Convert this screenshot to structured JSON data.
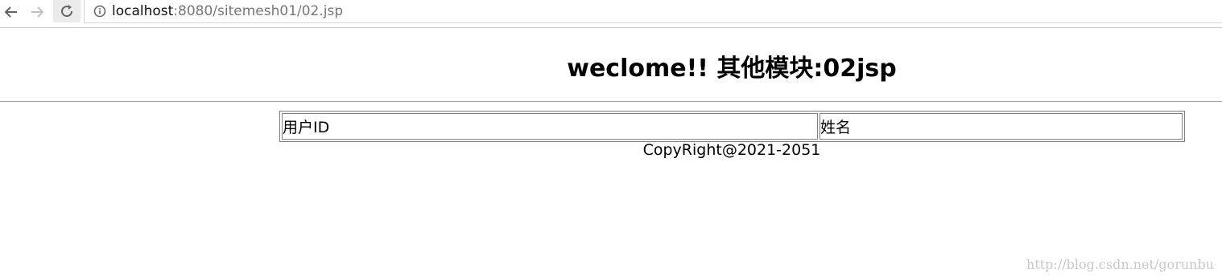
{
  "browser": {
    "url_host": "localhost",
    "url_path": ":8080/sitemesh01/02.jsp"
  },
  "page": {
    "heading": "weclome!! 其他模块:02jsp",
    "table": {
      "headers": [
        "用户ID",
        "姓名"
      ]
    },
    "footer": "CopyRight@2021-2051"
  },
  "watermark": "http://blog.csdn.net/gorunbu",
  "colors": {
    "divider": "#a0a0a0",
    "table_border": "#808080",
    "watermark": "#c9c9c9"
  }
}
